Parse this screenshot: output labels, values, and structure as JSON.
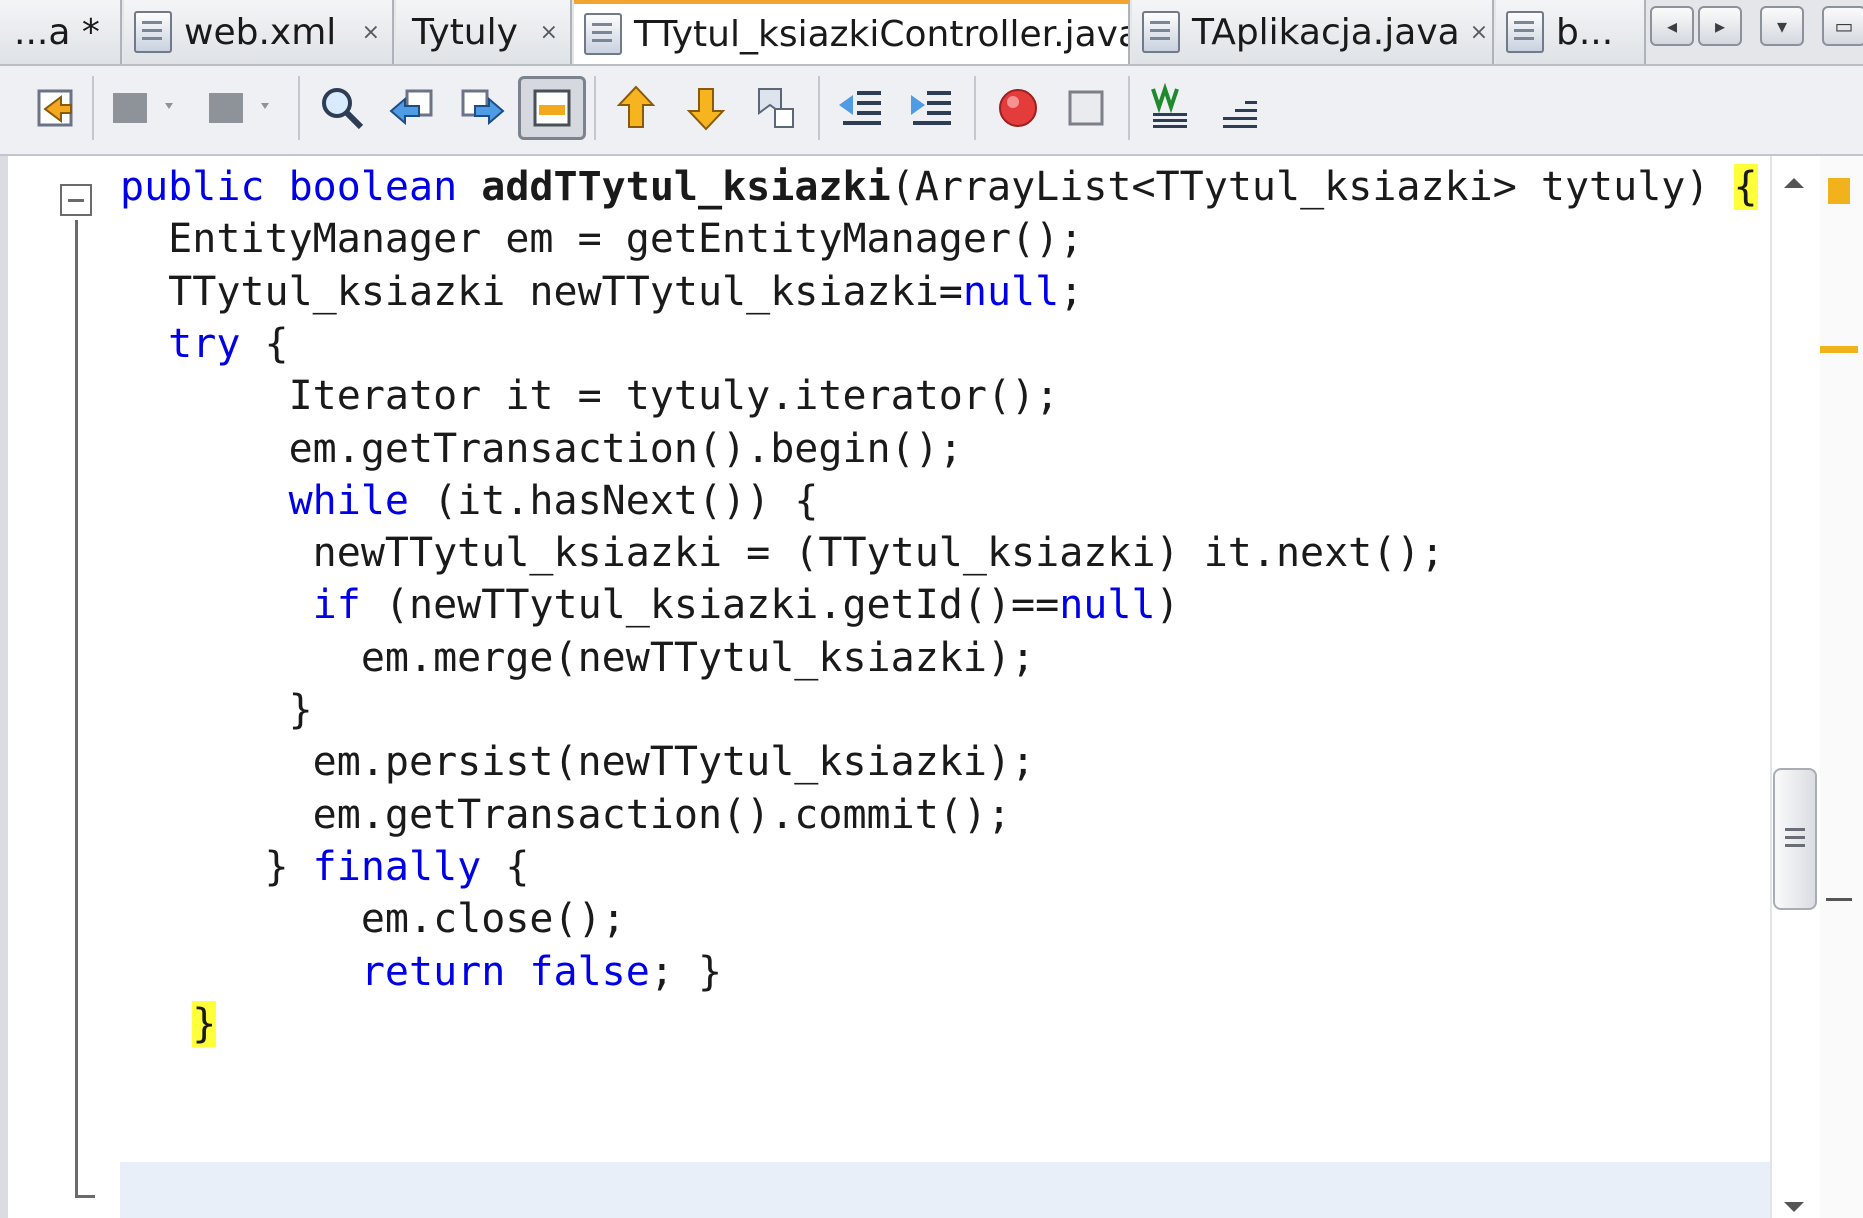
{
  "tabs": [
    {
      "label": "...a *"
    },
    {
      "label": "web.xml",
      "close": "⨯"
    },
    {
      "label": "Tytuly",
      "close": "⨯"
    },
    {
      "label": "TTytul_ksiazkiController.java",
      "close": "⨯",
      "active": true
    },
    {
      "label": "TAplikacja.java",
      "close": "⨯"
    },
    {
      "label": "b..."
    }
  ],
  "tab_nav": [
    "◂",
    "▸",
    "▾",
    "▭"
  ],
  "toolbar": {
    "buttons": [
      "last-edit-icon",
      "back-icon",
      "forward-icon",
      "find-icon",
      "find-previous-icon",
      "find-next-icon",
      "toggle-highlight-icon",
      "previous-bookmark-icon",
      "next-bookmark-icon",
      "toggle-bookmark-icon",
      "shift-left-icon",
      "shift-right-icon",
      "start-macro-icon",
      "stop-macro-icon",
      "comment-icon",
      "uncomment-icon"
    ]
  },
  "code_lines": [
    {
      "indent": "",
      "parts": [
        {
          "t": "public",
          "c": "kw"
        },
        {
          "t": " "
        },
        {
          "t": "boolean",
          "c": "kw"
        },
        {
          "t": " "
        },
        {
          "t": "addTTytul_ksiazki",
          "c": "bold"
        },
        {
          "t": "(ArrayList<TTytul_ksiazki> tytuly) "
        },
        {
          "t": "{",
          "c": "brace-hl"
        }
      ]
    },
    {
      "indent": "  ",
      "parts": [
        {
          "t": "EntityManager em = getEntityManager();"
        }
      ]
    },
    {
      "indent": "  ",
      "parts": [
        {
          "t": "TTytul_ksiazki newTTytul_ksiazki="
        },
        {
          "t": "null",
          "c": "kw"
        },
        {
          "t": ";"
        }
      ]
    },
    {
      "indent": "  ",
      "parts": [
        {
          "t": "try",
          "c": "kw"
        },
        {
          "t": " {"
        }
      ]
    },
    {
      "indent": "       ",
      "parts": [
        {
          "t": "Iterator it = tytuly.iterator();"
        }
      ]
    },
    {
      "indent": "       ",
      "parts": [
        {
          "t": "em.getTransaction().begin();"
        }
      ]
    },
    {
      "indent": "       ",
      "parts": [
        {
          "t": "while",
          "c": "kw"
        },
        {
          "t": " (it.hasNext()) {"
        }
      ]
    },
    {
      "indent": "        ",
      "parts": [
        {
          "t": "newTTytul_ksiazki = (TTytul_ksiazki) it.next();"
        }
      ]
    },
    {
      "indent": "        ",
      "parts": [
        {
          "t": "if",
          "c": "kw"
        },
        {
          "t": " (newTTytul_ksiazki.getId()=="
        },
        {
          "t": "null",
          "c": "kw"
        },
        {
          "t": ")"
        }
      ]
    },
    {
      "indent": "          ",
      "parts": [
        {
          "t": "em.merge(newTTytul_ksiazki);"
        }
      ]
    },
    {
      "indent": "       ",
      "parts": [
        {
          "t": "}"
        }
      ]
    },
    {
      "indent": "        ",
      "parts": [
        {
          "t": "em.persist(newTTytul_ksiazki);"
        }
      ]
    },
    {
      "indent": "        ",
      "parts": [
        {
          "t": "em.getTransaction().commit();"
        }
      ]
    },
    {
      "indent": "      ",
      "parts": [
        {
          "t": "} "
        },
        {
          "t": "finally",
          "c": "kw"
        },
        {
          "t": " {"
        }
      ]
    },
    {
      "indent": "          ",
      "parts": [
        {
          "t": "em.close();"
        }
      ]
    },
    {
      "indent": "          ",
      "parts": [
        {
          "t": "return",
          "c": "kw"
        },
        {
          "t": " "
        },
        {
          "t": "false",
          "c": "kw"
        },
        {
          "t": "; }"
        }
      ]
    },
    {
      "indent": "   ",
      "parts": [
        {
          "t": "}",
          "c": "brace-hl"
        }
      ]
    }
  ],
  "colors": {
    "keyword": "#0000e6",
    "brace_highlight": "#ffff3a",
    "current_line": "#e9eff8",
    "error_stripe": "#f2b21c"
  }
}
